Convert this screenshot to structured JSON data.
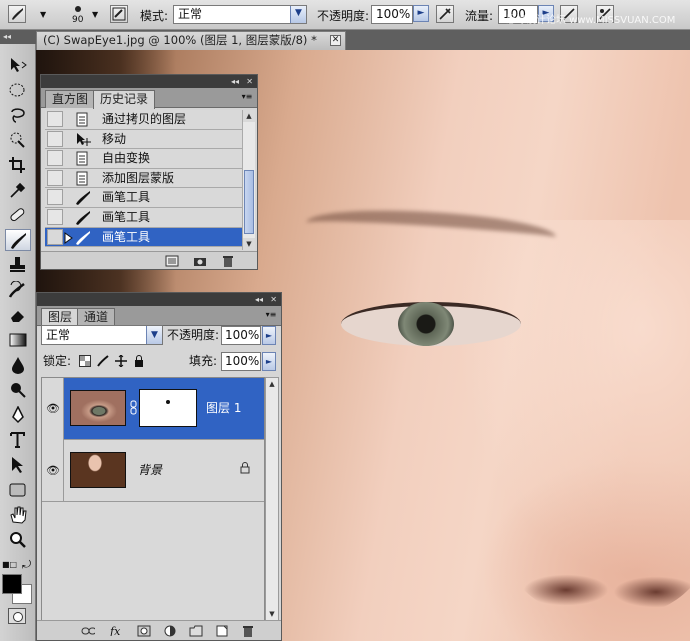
{
  "options_bar": {
    "brush_size": "90",
    "mode_label": "模式:",
    "mode_value": "正常",
    "opacity_label": "不透明度:",
    "opacity_value": "100%",
    "flow_label": "流量:",
    "flow_value": "100",
    "watermark": "思缘设计论坛 www.MISSVUAN.COM"
  },
  "document_tab": {
    "title": "(C) SwapEye1.jpg @ 100% (图层 1, 图层蒙版/8) *",
    "close_glyph": "✕"
  },
  "history_panel": {
    "tabs": [
      "直方图",
      "历史记录"
    ],
    "active_tab": 1,
    "items": [
      {
        "label": "通过拷贝的图层",
        "icon": "document-icon"
      },
      {
        "label": "移动",
        "icon": "move-icon"
      },
      {
        "label": "自由变换",
        "icon": "document-icon"
      },
      {
        "label": "添加图层蒙版",
        "icon": "document-icon"
      },
      {
        "label": "画笔工具",
        "icon": "brush-icon"
      },
      {
        "label": "画笔工具",
        "icon": "brush-icon"
      },
      {
        "label": "画笔工具",
        "icon": "brush-icon"
      }
    ],
    "selected_index": 6
  },
  "layers_panel": {
    "tabs": [
      "图层",
      "通道"
    ],
    "active_tab": 0,
    "blend_mode": "正常",
    "opacity_label": "不透明度:",
    "opacity_value": "100%",
    "lock_label": "锁定:",
    "fill_label": "填充:",
    "fill_value": "100%",
    "layers": [
      {
        "name": "图层 1",
        "selected": true,
        "has_mask": true
      },
      {
        "name": "背景",
        "selected": false,
        "locked": true
      }
    ]
  },
  "colors": {
    "selection": "#3063c3",
    "panel_bg": "#d6d6d6",
    "foreground": "#000000",
    "background": "#ffffff"
  }
}
